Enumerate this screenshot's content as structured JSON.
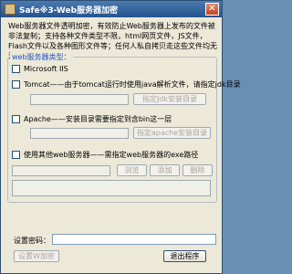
{
  "window": {
    "title": "Safe※3-Web服务器加密"
  },
  "description": "Web服务器文件透明加密，有效防止Web服务器上发布的文件被非法复制；支持各种文件类型不限，html网页文件，JS文件，Flash文件以及各种图形文件等；任何人私自拷贝走这些文件均无法使用。",
  "server_group": {
    "title": "web服务器类型：",
    "iis_label": "Microsoft IIS",
    "tomcat_label": "Tomcat——由于tomcat运行时使用java解析文件，请指定jdk目录",
    "jdk_button": "指定Jdk安装目录",
    "apache_label": "Apache——安装目录需要指定到含bin这一层",
    "apache_button": "指定apache安装目录",
    "other_label": "使用其他web服务器——需指定web服务器的exe路径",
    "browse_button": "浏览",
    "add_button": "添加",
    "delete_button": "删除"
  },
  "password": {
    "label": "设置密码："
  },
  "footer": {
    "set_encrypt_button": "设置W加密",
    "exit_button": "退出程序"
  }
}
